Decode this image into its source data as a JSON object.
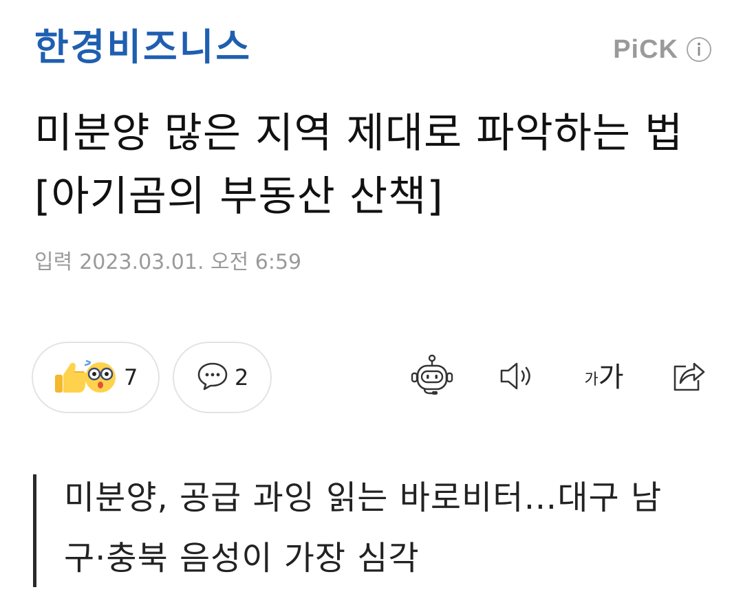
{
  "header": {
    "press_name": "한경비즈니스",
    "pick_label": "PiCK",
    "brand_color": "#1f5fb0",
    "info_icon": "info-circle-icon"
  },
  "article": {
    "title": "미분양 많은 지역 제대로 파악하는 법[아기곰의 부동산 산책]",
    "date_label": "입력",
    "date_value": "2023.03.01. 오전 6:59",
    "subtitle": "미분양, 공급 과잉 읽는 바로비터…대구 남구·충북 음성이 가장 심각"
  },
  "actions": {
    "reaction_count": "7",
    "comment_count": "2",
    "font_small": "가",
    "font_big": "가",
    "icons": [
      "thumbs-up-emoji-icon",
      "surprised-emoji-icon",
      "comment-bubble-icon",
      "robot-summary-icon",
      "speaker-icon",
      "share-icon"
    ]
  }
}
